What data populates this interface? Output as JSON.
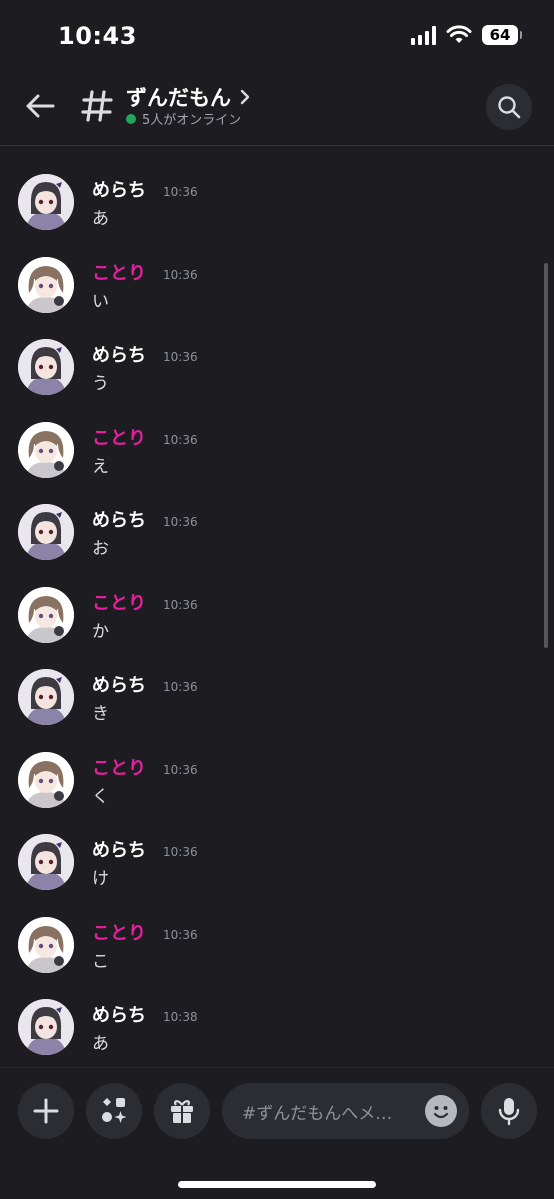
{
  "status_bar": {
    "time": "10:43",
    "battery": "64"
  },
  "header": {
    "channel_name": "ずんだもん",
    "online_text": "5人がオンライン"
  },
  "users": {
    "merachi": {
      "name": "めらち",
      "color": "#ffffff"
    },
    "kotori": {
      "name": "ことり",
      "color": "#e91fa0"
    }
  },
  "messages": [
    {
      "user": "めらち",
      "time": "10:36",
      "text": "あ"
    },
    {
      "user": "ことり",
      "time": "10:36",
      "text": "い"
    },
    {
      "user": "めらち",
      "time": "10:36",
      "text": "う"
    },
    {
      "user": "ことり",
      "time": "10:36",
      "text": "え"
    },
    {
      "user": "めらち",
      "time": "10:36",
      "text": "お"
    },
    {
      "user": "ことり",
      "time": "10:36",
      "text": "か"
    },
    {
      "user": "めらち",
      "time": "10:36",
      "text": "き"
    },
    {
      "user": "ことり",
      "time": "10:36",
      "text": "く"
    },
    {
      "user": "めらち",
      "time": "10:36",
      "text": "け"
    },
    {
      "user": "ことり",
      "time": "10:36",
      "text": "こ"
    },
    {
      "user": "めらち",
      "time": "10:38",
      "text": "あ"
    }
  ],
  "composer": {
    "placeholder": "#ずんだもんへメ…"
  },
  "icons": [
    "back-arrow-icon",
    "hash-icon",
    "chevron-right-icon",
    "search-icon",
    "plus-icon",
    "apps-icon",
    "gift-icon",
    "emoji-icon",
    "microphone-icon"
  ]
}
